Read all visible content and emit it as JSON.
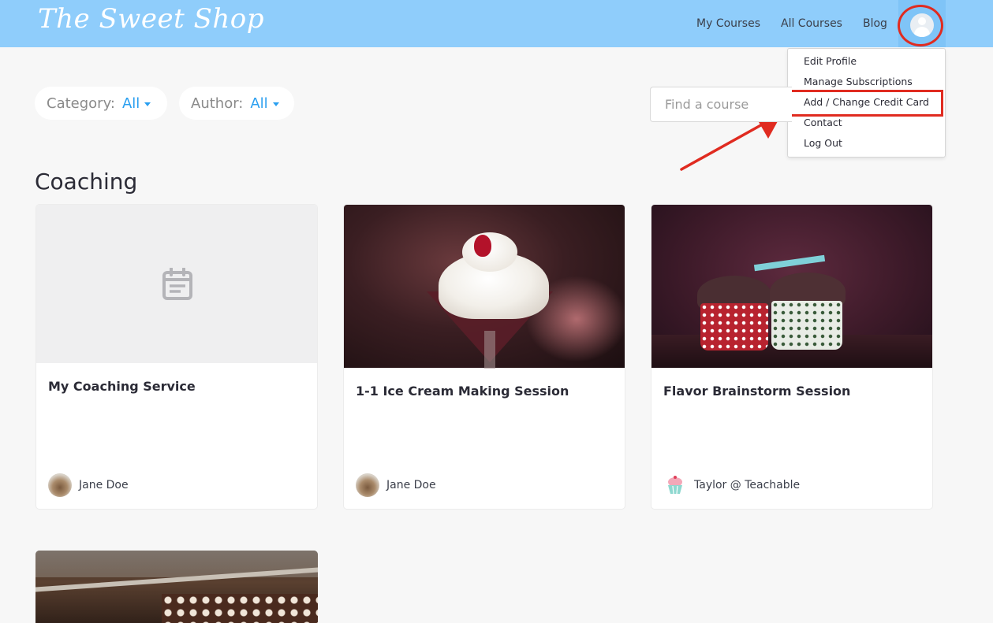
{
  "header": {
    "logo": "The Sweet Shop",
    "nav": [
      "My Courses",
      "All Courses",
      "Blog"
    ]
  },
  "dropdown": {
    "items": [
      "Edit Profile",
      "Manage Subscriptions",
      "Add / Change Credit Card",
      "Contact",
      "Log Out"
    ]
  },
  "filters": {
    "category_label": "Category:",
    "category_value": "All",
    "author_label": "Author:",
    "author_value": "All"
  },
  "search": {
    "placeholder": "Find a course"
  },
  "section": {
    "title": "Coaching"
  },
  "cards": [
    {
      "title": "My Coaching Service",
      "author": "Jane Doe"
    },
    {
      "title": "1-1 Ice Cream Making Session",
      "author": "Jane Doe"
    },
    {
      "title": "Flavor Brainstorm Session",
      "author": "Taylor @ Teachable"
    }
  ],
  "colors": {
    "header": "#8fcdfb",
    "accent": "#2a9ff0",
    "annotation": "#e02b20"
  }
}
